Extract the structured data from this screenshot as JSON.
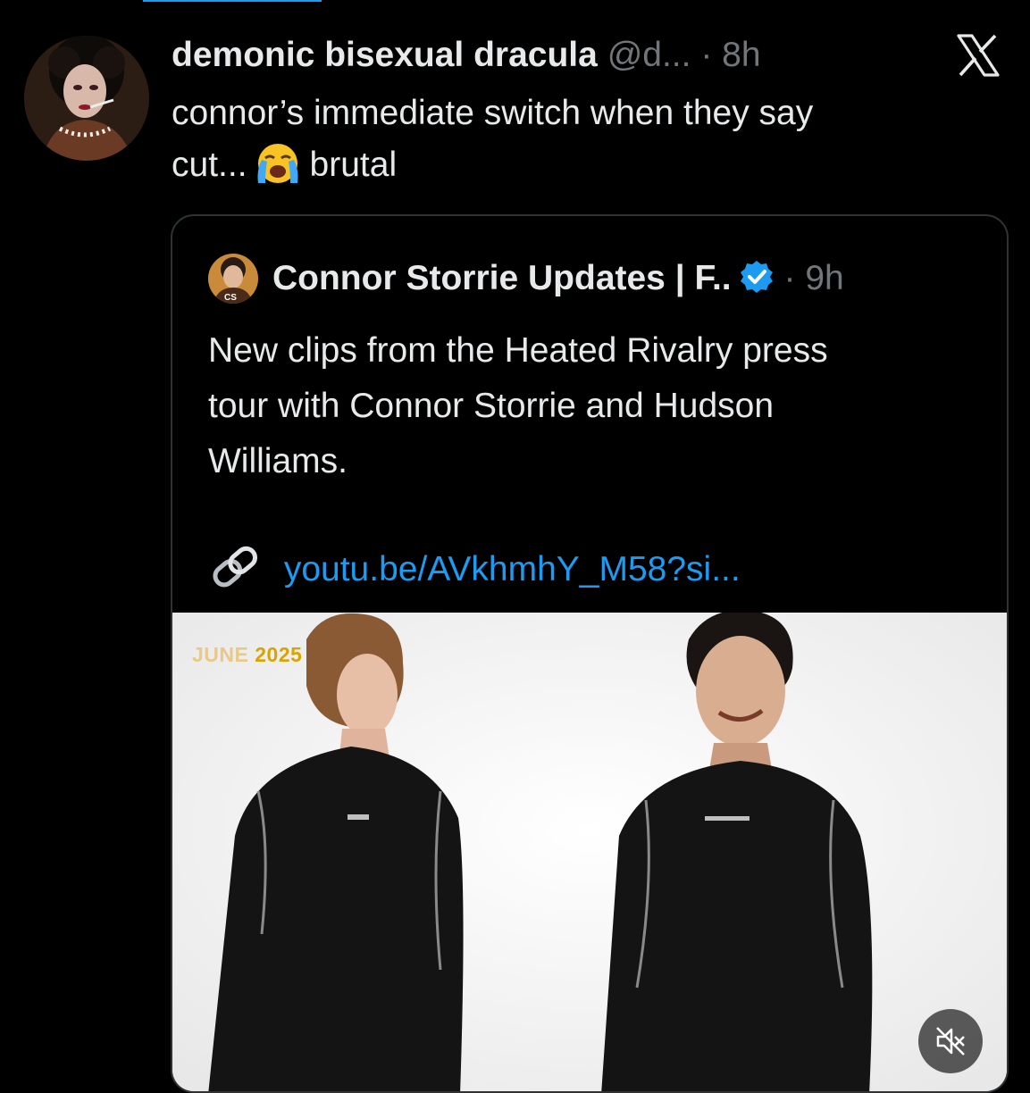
{
  "tweet": {
    "display_name": "demonic bisexual dracula",
    "handle": "@d...",
    "separator": "·",
    "time": "8h",
    "text_line1": "connor’s immediate switch when they say",
    "text_line2_before": "cut...",
    "emoji": "loudly-crying-face-emoji",
    "text_line2_after": "brutal"
  },
  "brand": {
    "logo": "x-logo-icon"
  },
  "quote": {
    "display_name": "Connor Storrie Updates | F..",
    "verified": "verified-badge-icon",
    "separator": "·",
    "time": "9h",
    "text_line1": "New clips from the Heated Rivalry press",
    "text_line2": "tour with Connor Storrie and Hudson",
    "text_line3": "Williams.",
    "link_icon": "link-icon",
    "link_text": "youtu.be/AVkhmhY_M58?si...",
    "media": {
      "overlay_month": "JUNE",
      "overlay_year": "2025",
      "mute_icon": "mute-icon"
    }
  },
  "colors": {
    "background": "#000000",
    "text": "#e7e9ea",
    "secondary": "#71767b",
    "link": "#1d9bf0",
    "border": "#2f3336"
  }
}
